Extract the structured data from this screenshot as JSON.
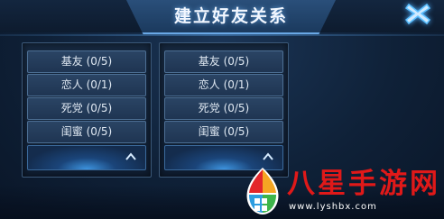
{
  "dialog": {
    "title": "建立好友关系",
    "close_icon": "close-x-icon"
  },
  "panels": [
    {
      "rows": [
        "基友 (0/5)",
        "恋人 (0/1)",
        "死党 (0/5)",
        "闺蜜 (0/5)"
      ],
      "footer_icon": "chevron-up-icon"
    },
    {
      "rows": [
        "基友 (0/5)",
        "恋人 (0/1)",
        "死党 (0/5)",
        "闺蜜 (0/5)"
      ],
      "footer_icon": "chevron-up-icon"
    }
  ],
  "watermark": {
    "brand": "八星手游网",
    "url": "www.lyshbx.com"
  },
  "colors": {
    "accent": "#4fb0ff",
    "title_text": "#f2f7ff",
    "row_text": "#dfe8f2",
    "watermark_red": "#e01919"
  }
}
